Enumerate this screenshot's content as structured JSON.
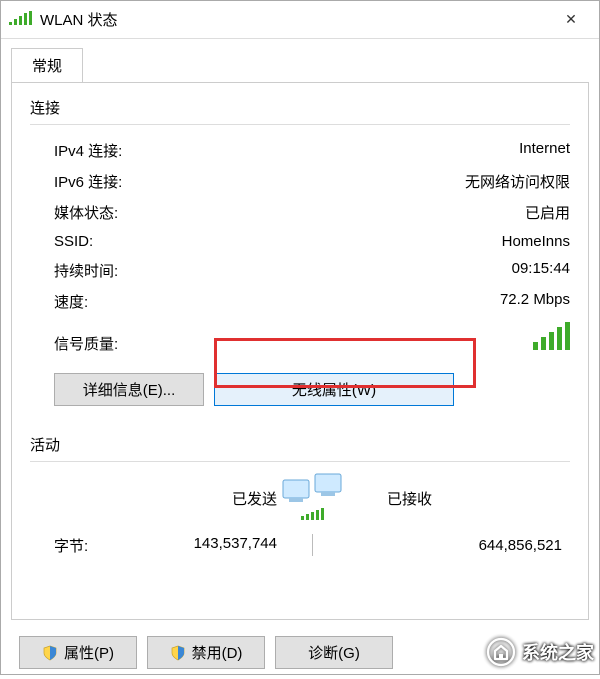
{
  "window": {
    "title": "WLAN 状态",
    "close_symbol": "✕"
  },
  "tab": {
    "general": "常规"
  },
  "connection": {
    "group_label": "连接",
    "ipv4_label": "IPv4 连接:",
    "ipv4_value": "Internet",
    "ipv6_label": "IPv6 连接:",
    "ipv6_value": "无网络访问权限",
    "media_label": "媒体状态:",
    "media_value": "已启用",
    "ssid_label": "SSID:",
    "ssid_value": "HomeInns",
    "duration_label": "持续时间:",
    "duration_value": "09:15:44",
    "speed_label": "速度:",
    "speed_value": "72.2 Mbps",
    "signal_label": "信号质量:"
  },
  "buttons": {
    "details": "详细信息(E)...",
    "wireless": "无线属性(W)",
    "properties": "属性(P)",
    "disable": "禁用(D)",
    "diagnose": "诊断(G)"
  },
  "activity": {
    "group_label": "活动",
    "sent_label": "已发送",
    "recv_label": "已接收",
    "bytes_label": "字节:",
    "sent_value": "143,537,744",
    "recv_value": "644,856,521"
  },
  "watermark": {
    "text": "系统之家"
  }
}
